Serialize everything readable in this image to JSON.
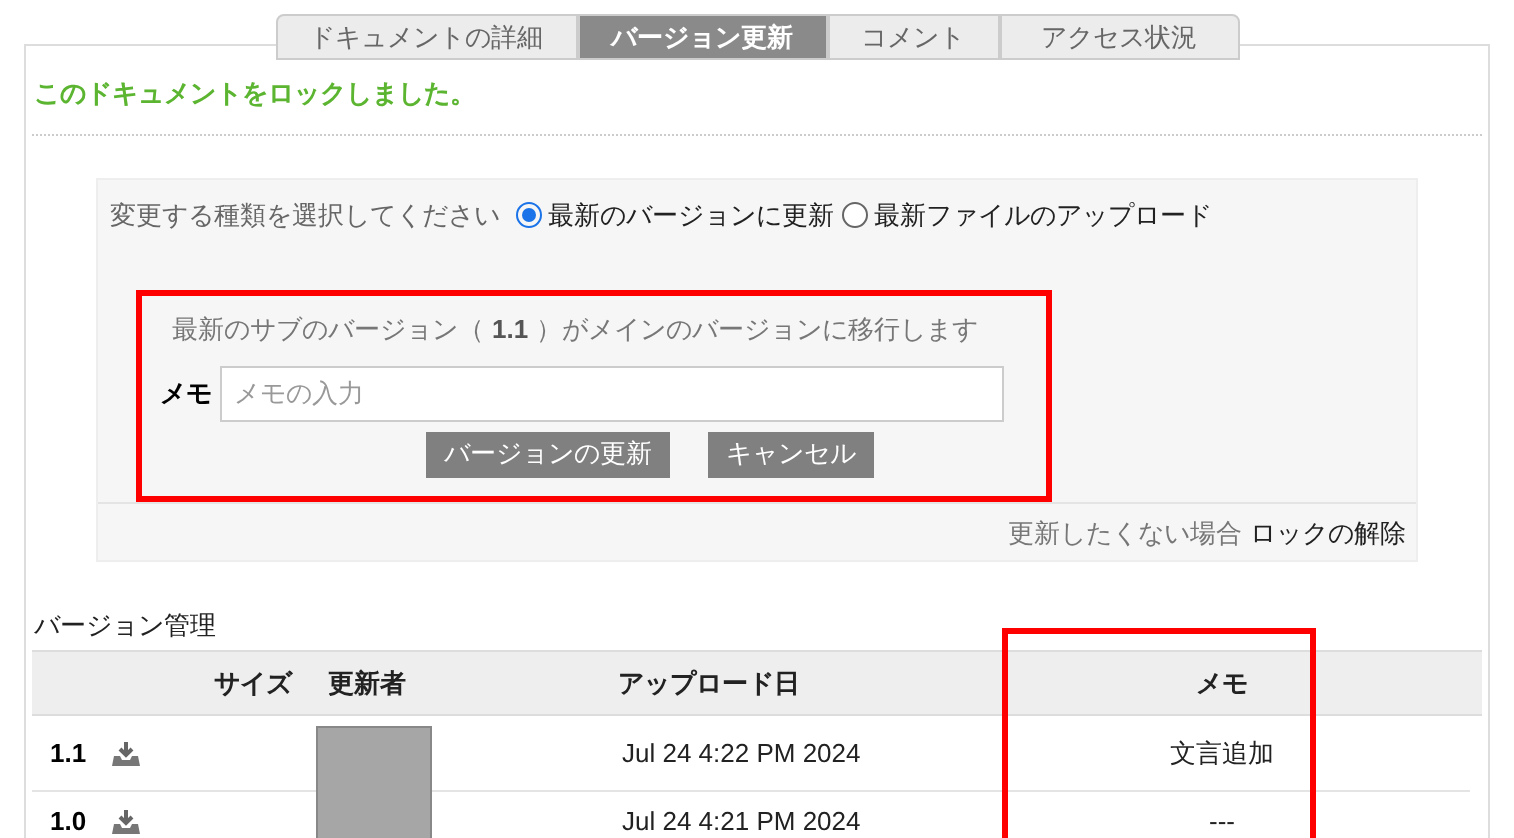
{
  "tabs": [
    {
      "label": "ドキュメントの詳細",
      "selected": false
    },
    {
      "label": "バージョン更新",
      "selected": true
    },
    {
      "label": "コメント",
      "selected": false
    },
    {
      "label": "アクセス状況",
      "selected": false
    }
  ],
  "lock_message": "このドキュメントをロックしました。",
  "change_type": {
    "prompt": "変更する種類を選択してください",
    "options": [
      {
        "label": "最新のバージョンに更新",
        "selected": true
      },
      {
        "label": "最新ファイルのアップロード",
        "selected": false
      }
    ]
  },
  "update_panel": {
    "notice_before": "最新のサブのバージョン（",
    "version": "1.1",
    "notice_after": "）がメインのバージョンに移行します",
    "memo_label": "メモ",
    "memo_placeholder": "メモの入力",
    "buttons": [
      "バージョンの更新",
      "キャンセル"
    ]
  },
  "unlock": {
    "text": "更新したくない場合",
    "link": "ロックの解除"
  },
  "versions": {
    "title": "バージョン管理",
    "columns": [
      "サイズ",
      "更新者",
      "アップロード日",
      "メモ"
    ],
    "rows": [
      {
        "version": "1.1",
        "date": "Jul 24 4:22 PM 2024",
        "memo": "文言追加"
      },
      {
        "version": "1.0",
        "date": "Jul 24 4:21 PM 2024",
        "memo": "---"
      }
    ]
  }
}
